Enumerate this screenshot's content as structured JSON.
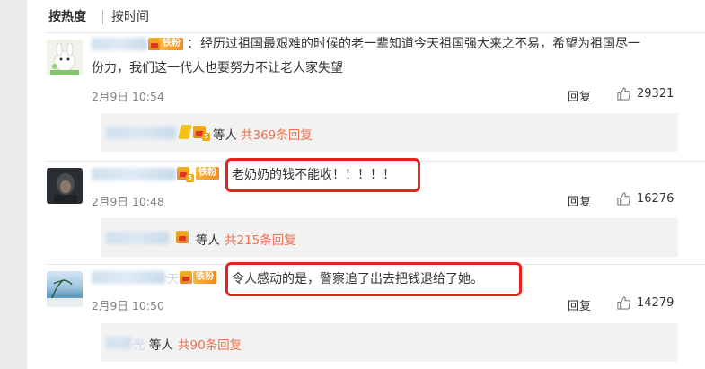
{
  "sort": {
    "hot": "按热度",
    "time": "按时间"
  },
  "comments": [
    {
      "fan_badge": "铁粉",
      "colon": "：",
      "text_line1": "经历过祖国最艰难的时候的老一辈知道今天祖国强大来之不易，希望为祖国尽一",
      "text_line2": "份力，我们这一代人也要努力不让老人家失望",
      "time": "2月9日 10:54",
      "reply_label": "回复",
      "likes": "29321",
      "replies": {
        "etc": "等人",
        "count_text": "共369条回复",
        "level": "5"
      }
    },
    {
      "fan_badge": "铁粉",
      "colon": "：",
      "text": "老奶奶的钱不能收！！！！！",
      "time": "2月9日 10:48",
      "reply_label": "回复",
      "likes": "16276",
      "level": "5",
      "replies": {
        "etc": "等人",
        "count_text": "共215条回复"
      }
    },
    {
      "fan_badge": "铁粉",
      "colon": "：",
      "text": "令人感动的是，警察追了出去把钱退给了她。",
      "time": "2月9日 10:50",
      "reply_label": "回复",
      "likes": "14279",
      "name_tail": "天",
      "replies": {
        "etc": "等人",
        "count_text": "共90条回复",
        "name_tail": "光"
      }
    }
  ],
  "colors": {
    "link": "#eb7350",
    "highlight_border": "#e5221b",
    "badge": "#f08a1e"
  },
  "icons": [
    "crown-icon",
    "fan-badge",
    "thumbs-up-icon",
    "vip-diamond-icon"
  ]
}
